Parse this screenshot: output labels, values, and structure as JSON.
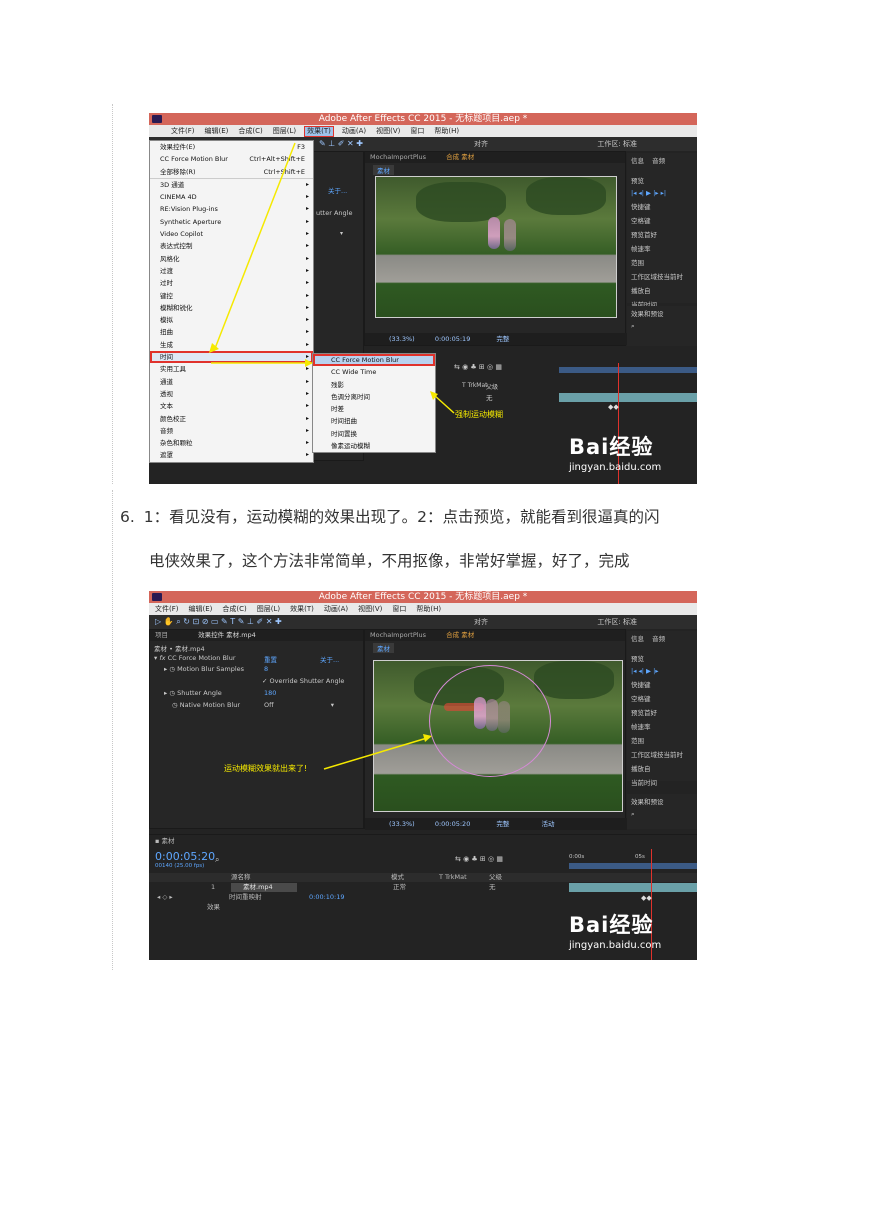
{
  "step": {
    "number": "6.",
    "line1": "1：看见没有，运动模糊的效果出现了。2：点击预览，就能看到很逼真的闪",
    "line2": "电侠效果了，这个方法非常简单，不用抠像，非常好掌握，好了，完成"
  },
  "shot1": {
    "title": "Adobe After Effects CC 2015 - 无标题项目.aep *",
    "menubar": [
      "文件(F)",
      "编辑(E)",
      "合成(C)",
      "图层(L)",
      "效果(T)",
      "动画(A)",
      "视图(V)",
      "窗口",
      "帮助(H)"
    ],
    "active_menu": "效果(T)",
    "toolbar": {
      "snap": "对齐",
      "workspace_label": "工作区:",
      "workspace_value": "标准"
    },
    "effects_menu": [
      {
        "label": "效果控件(E)",
        "shortcut": "F3"
      },
      {
        "label": "CC Force Motion Blur",
        "shortcut": "Ctrl+Alt+Shift+E"
      },
      {
        "label": "全部移除(R)",
        "shortcut": "Ctrl+Shift+E"
      },
      {
        "label": "3D 通道",
        "arrow": "▸"
      },
      {
        "label": "CINEMA 4D",
        "arrow": "▸"
      },
      {
        "label": "RE:Vision Plug-ins",
        "arrow": "▸"
      },
      {
        "label": "Synthetic Aperture",
        "arrow": "▸"
      },
      {
        "label": "Video Copilot",
        "arrow": "▸"
      },
      {
        "label": "表达式控制",
        "arrow": "▸"
      },
      {
        "label": "风格化",
        "arrow": "▸"
      },
      {
        "label": "过渡",
        "arrow": "▸"
      },
      {
        "label": "过时",
        "arrow": "▸"
      },
      {
        "label": "键控",
        "arrow": "▸"
      },
      {
        "label": "模糊和锐化",
        "arrow": "▸"
      },
      {
        "label": "模拟",
        "arrow": "▸"
      },
      {
        "label": "扭曲",
        "arrow": "▸"
      },
      {
        "label": "生成",
        "arrow": "▸"
      },
      {
        "label": "时间",
        "arrow": "▸"
      },
      {
        "label": "实用工具",
        "arrow": "▸"
      },
      {
        "label": "通道",
        "arrow": "▸"
      },
      {
        "label": "透视",
        "arrow": "▸"
      },
      {
        "label": "文本",
        "arrow": "▸"
      },
      {
        "label": "颜色校正",
        "arrow": "▸"
      },
      {
        "label": "音频",
        "arrow": "▸"
      },
      {
        "label": "杂色和颗粒",
        "arrow": "▸"
      },
      {
        "label": "遮罩",
        "arrow": "▸"
      }
    ],
    "time_submenu": [
      "CC Force Motion Blur",
      "CC Wide Time",
      "残影",
      "色调分离时间",
      "时差",
      "时间扭曲",
      "时间置换",
      "像素运动模糊"
    ],
    "comp_tab": "MochaImportPlus",
    "comp_name": "合成 素材",
    "comp_label": "素材",
    "viewer_status": {
      "zoom": "(33.3%)",
      "timecode": "0:00:05:19",
      "quality": "完整"
    },
    "effect_controls_about": "关于...",
    "effect_controls_partial": "utter Angle",
    "right_panel": [
      "信息",
      "音频",
      "预览",
      "快捷键",
      "空格键",
      "预览首好",
      "帧速率",
      "范围",
      "工作区域技当前时",
      "播放自",
      "当前时间"
    ],
    "effects_presets": "效果和预设",
    "trkmat_label": "T TrkMat",
    "parent_label": "父级",
    "parent_value": "无",
    "annotation": "强制运动模糊",
    "watermark": {
      "brand": "Bai经验",
      "url": "jingyan.baidu.com"
    }
  },
  "shot2": {
    "title": "Adobe After Effects CC 2015 - 无标题项目.aep *",
    "menubar": [
      "文件(F)",
      "编辑(E)",
      "合成(C)",
      "图层(L)",
      "效果(T)",
      "动画(A)",
      "视图(V)",
      "窗口",
      "帮助(H)"
    ],
    "toolbar": {
      "snap": "对齐",
      "workspace_label": "工作区:",
      "workspace_value": "标准"
    },
    "effect_controls_tab": "效果控件 素材.mp4",
    "project_tab": "项目",
    "layer_path": "素材 • 素材.mp4",
    "fx": {
      "name": "CC Force Motion Blur",
      "reset": "重置",
      "about": "关于...",
      "samples_label": "Motion Blur Samples",
      "samples_value": "8",
      "override_label": "Override Shutter Angle",
      "shutter_label": "Shutter Angle",
      "shutter_value": "180",
      "native_label": "Native Motion Blur",
      "native_value": "Off"
    },
    "comp_tab": "MochaImportPlus",
    "comp_name": "合成 素材",
    "comp_label": "素材",
    "viewer_status": {
      "zoom": "(33.3%)",
      "timecode": "0:00:05:20",
      "quality": "完整",
      "active": "活动"
    },
    "right_panel": [
      "信息",
      "音频",
      "预览",
      "快捷键",
      "空格键",
      "预览首好",
      "帧速率",
      "范围",
      "工作区域技当前时",
      "播放自",
      "当前时间"
    ],
    "effects_presets": "效果和预设",
    "timeline": {
      "tab": "素材",
      "timecode": "0:00:05:20",
      "fps": "00140 (25.00 fps)",
      "col_source": "源名称",
      "col_mode": "模式",
      "col_trkmat": "T TrkMat",
      "col_parent": "父级",
      "layer_index": "1",
      "layer_name": "素材.mp4",
      "layer_mode": "正常",
      "parent_value": "无",
      "remap_label": "时间重映射",
      "remap_value": "0:00:10:19",
      "effects_label": "效果",
      "ruler_start": "0:00s",
      "ruler_mark": "05s"
    },
    "annotation": "运动模糊效果就出来了!",
    "watermark": {
      "brand": "Bai经验",
      "url": "jingyan.baidu.com"
    }
  }
}
